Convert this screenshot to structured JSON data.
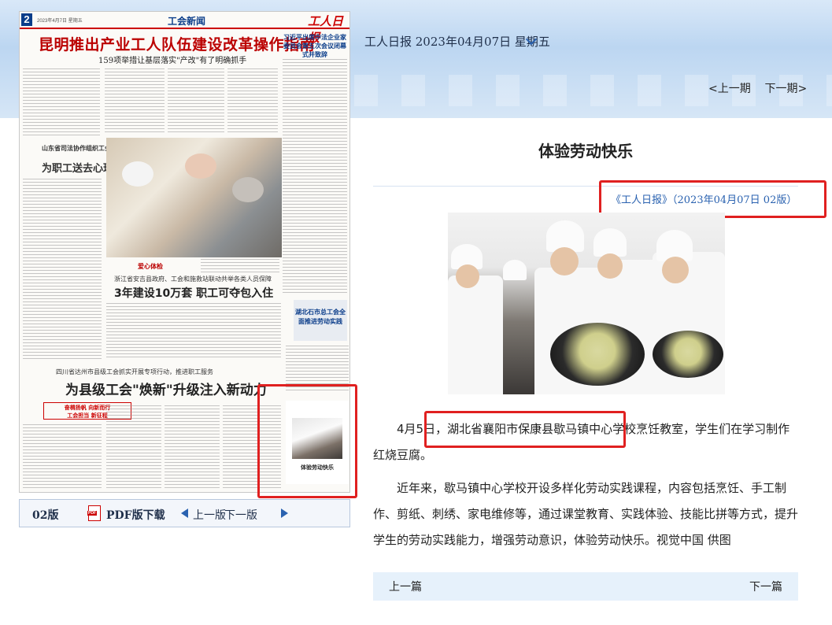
{
  "newspaper": {
    "page_number": "2",
    "date_line": "2023年4月7日 星期五",
    "section": "工会新闻",
    "masthead": "工人日报",
    "headline": "昆明推出产业工人队伍建设改革操作指南",
    "subheadline": "159项举措让基层落实\"产改\"有了明确抓手",
    "side_title": "习近平出席中法企业家委员会第五次会议闭幕式并致辞",
    "photo_caption": "爱心体检",
    "mid_subhead": "浙江省安吉县政府、工会和施救站联动共举各类人员保障",
    "mid_headline": "3年建设10万套 职工可夺包入住",
    "left_title_small": "山东省司法协作组织工会",
    "left_title": "为职工送去心理关爱",
    "right_box_title": "湖北石市总工会全面推进劳动实践",
    "sub3": "四川省达州市县级工会抓实开展专项行动，推进职工服务",
    "head3": "为县级工会\"焕新\"升级注入新动力",
    "badge_line1": "奋楫扬帆 向新而行",
    "badge_line2": "工会担当 新征程",
    "thumb_caption": "体验劳动快乐"
  },
  "paper_nav": {
    "edition": "02版",
    "pdf_label": "PDF版下载",
    "prev": "上一版",
    "next": "下一版"
  },
  "header": {
    "date_selector": "工人日报 2023年04月07日 星期五",
    "prev_page": "<上一期",
    "next_page": "下一期>"
  },
  "article": {
    "title": "体验劳动快乐",
    "source": "《工人日报》（2023年04月07日 02版）",
    "para1": "4月5日，湖北省襄阳市保康县歇马镇中心学校烹饪教室，学生们在学习制作红烧豆腐。",
    "para2": "近年来，歇马镇中心学校开设多样化劳动实践课程，内容包括烹饪、手工制作、剪纸、刺绣、家电维修等，通过课堂教育、实践体验、技能比拼等方式，提升学生的劳动实践能力，增强劳动意识，体验劳动快乐。视觉中国 供图"
  },
  "article_nav": {
    "prev": "上一篇",
    "next": "下一篇"
  },
  "colors": {
    "highlight_box": "#e02020",
    "link_blue": "#2a62b0",
    "header_band": "#bcd6f1",
    "masthead_red": "#cc0000"
  }
}
